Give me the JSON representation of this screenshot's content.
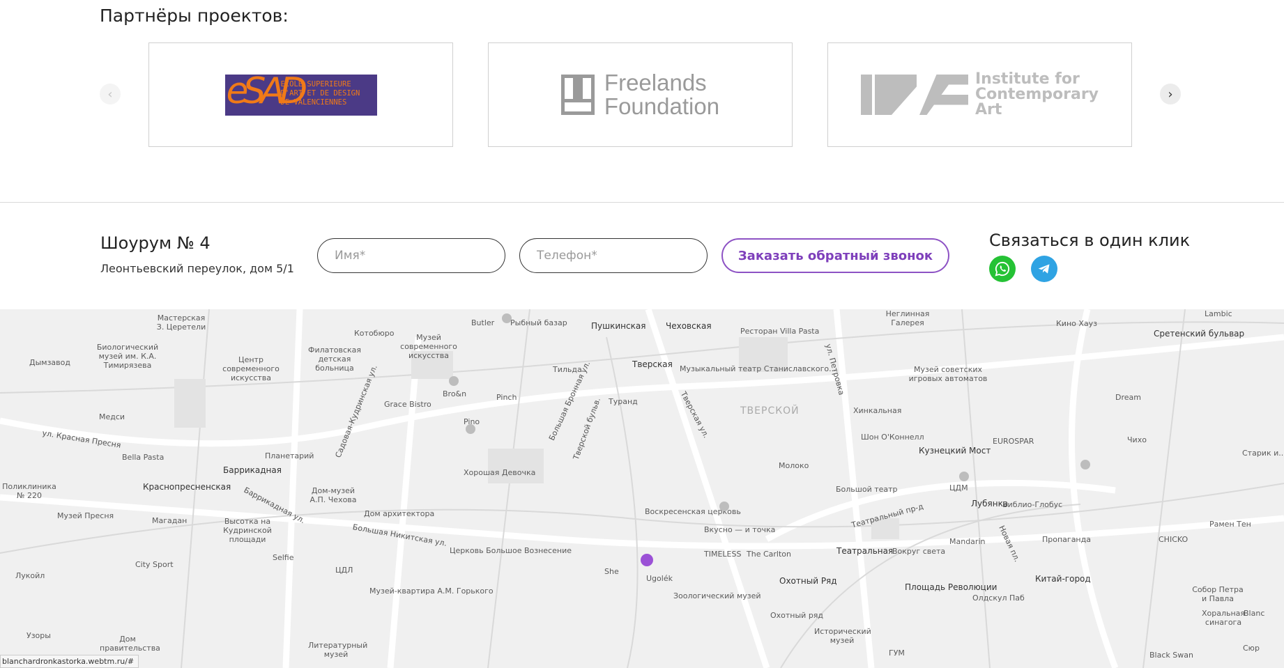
{
  "partners": {
    "title": "Партнёры проектов:",
    "prev_arrow": "‹",
    "next_arrow": "›",
    "logos": [
      {
        "mark": "eSAD",
        "text": "ECOLE SUPERIEURE\nD'ART ET DE DESIGN\nDE VALENCIENNES",
        "bg_color": "#4b3a86",
        "fg_color": "#f07a18"
      },
      {
        "text_line1": "Freelands",
        "text_line2": "Foundation",
        "color": "#9a9a9a"
      },
      {
        "text_line1": "Institute for",
        "text_line2": "Contemporary",
        "text_line3": "Art",
        "color": "#bdbdbd"
      }
    ]
  },
  "showroom": {
    "title": "Шоурум № 4",
    "address": "Леонтьевский переулок, дом 5/1"
  },
  "form": {
    "name_placeholder": "Имя*",
    "phone_placeholder": "Телефон*",
    "submit_label": "Заказать обратный звонок",
    "accent_color": "#8d52c4"
  },
  "contact": {
    "title": "Связаться в один клик",
    "icons": [
      "whatsapp-icon",
      "telegram-icon"
    ]
  },
  "map": {
    "district": "ТВЕРСКОЙ",
    "metro": [
      "Пушкинская",
      "Чеховская",
      "Тверская",
      "Баррикадная",
      "Краснопресненская",
      "Кузнецкий Мост",
      "Лубянка",
      "Театральная",
      "Охотный Ряд",
      "Площадь Революции",
      "Китай-город",
      "Сретенский бульвар"
    ],
    "streets": [
      "ул. Красная Пресня",
      "Садовая-Кудринская ул.",
      "Тверская ул.",
      "Большая Никитская ул.",
      "Театральный пр-д",
      "Новая пл.",
      "Баррикадная ул.",
      "Большая Бронная ул.",
      "Тверской бульв.",
      "ул. Петровка"
    ],
    "places": [
      "Рыбный базар",
      "Butler",
      "Ресторан Villa Pasta",
      "Музыкальный театр Станиславского...",
      "Bro&n",
      "Pinch",
      "Pino",
      "Туранд",
      "Тильда",
      "Grace Bistro",
      "Хорошая Девочка",
      "Воскресенская церковь",
      "Вкусно — и точка",
      "TIMELESS",
      "The Carlton",
      "Ugolék",
      "She",
      "Зоологический музей",
      "Церковь Большое Вознесение",
      "Дом архитектора",
      "Музей-квартира А.М. Горького",
      "Большой театр",
      "ЦДМ",
      "Библио-Глобус",
      "Хинкальная",
      "Шон О'Коннелл",
      "EUROSPAR",
      "Молоко",
      "Mandarin",
      "Вокруг света",
      "Пропаганда",
      "CHICKO",
      "Рамен Тен",
      "Dream",
      "Чихо",
      "Кино Хауз",
      "Музей советских игровых автоматов",
      "ГУМ",
      "Исторический музей",
      "Охотный ряд",
      "Олдскул Паб",
      "Собор Петра и Павла",
      "Хоральная синагога",
      "Blanc",
      "Black Swan",
      "Lambic",
      "Котобюро",
      "Музей современного искусства",
      "Филатовская детская больница",
      "Центр современного искусства",
      "Медси",
      "Bella Pasta",
      "Планетарий",
      "Дом-музей А.П. Чехова",
      "Высотка на Кудринской площади",
      "Магадан",
      "Музей Пресня",
      "Поликлиника № 220",
      "City Sport",
      "Лукойл",
      "Selfie",
      "ЦДЛ",
      "Литературный музей",
      "Дом правительства",
      "Биологический музей им. К.А. Тимирязева",
      "Дымзавод",
      "Мастерская З. Церетели",
      "Неглинная Галерея",
      "Узоры",
      "Сюр",
      "Старик и..."
    ],
    "status_url": "blanchardronkastorka.webtm.ru/#"
  }
}
